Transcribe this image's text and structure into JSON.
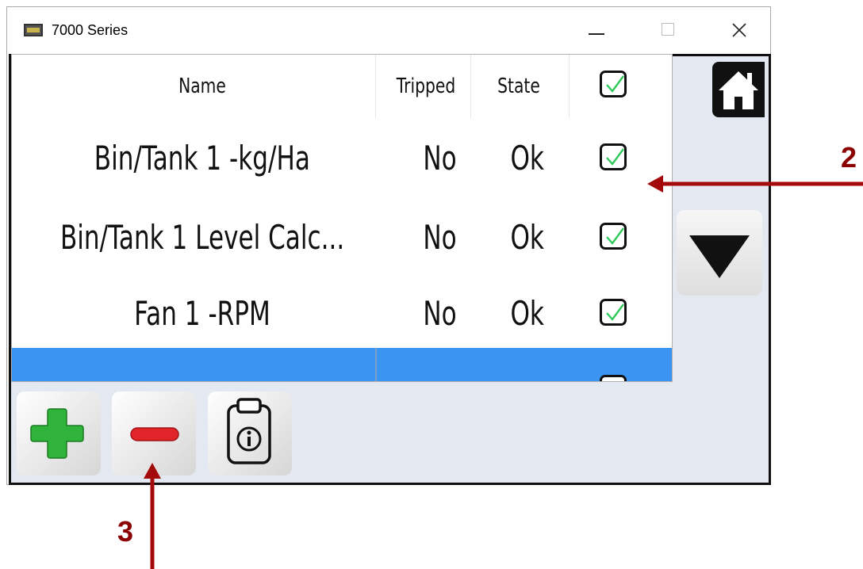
{
  "window": {
    "title": "7000 Series",
    "icon": "app-icon",
    "controls": [
      "minimize-icon",
      "maximize-icon",
      "close-icon"
    ]
  },
  "table": {
    "headers": {
      "name": "Name",
      "tripped": "Tripped",
      "state": "State",
      "check": "checkbox-checked-icon"
    },
    "rows": [
      {
        "name": "Bin/Tank 1 -kg/Ha",
        "tripped": "No",
        "state": "Ok",
        "checked": true
      },
      {
        "name": "Bin/Tank 1 Level Calc...",
        "tripped": "No",
        "state": "Ok",
        "checked": true
      },
      {
        "name": "Fan 1 -RPM",
        "tripped": "No",
        "state": "Ok",
        "checked": true
      }
    ],
    "selected_row": "partially-visible-selected-row"
  },
  "buttons": {
    "home": "home-icon",
    "scroll_down": "down-triangle-icon",
    "add": "plus-icon",
    "remove": "minus-icon",
    "info": "clipboard-info-icon"
  },
  "annotations": {
    "arrow_2_label": "2",
    "arrow_3_label": "3"
  },
  "colors": {
    "panel_bg": "#e4e9f1",
    "selection": "#3b94f0",
    "check_green": "#2ec95a",
    "plus_green": "#2fb33a",
    "minus_red": "#e0242a",
    "annotation": "#a50a0a"
  }
}
